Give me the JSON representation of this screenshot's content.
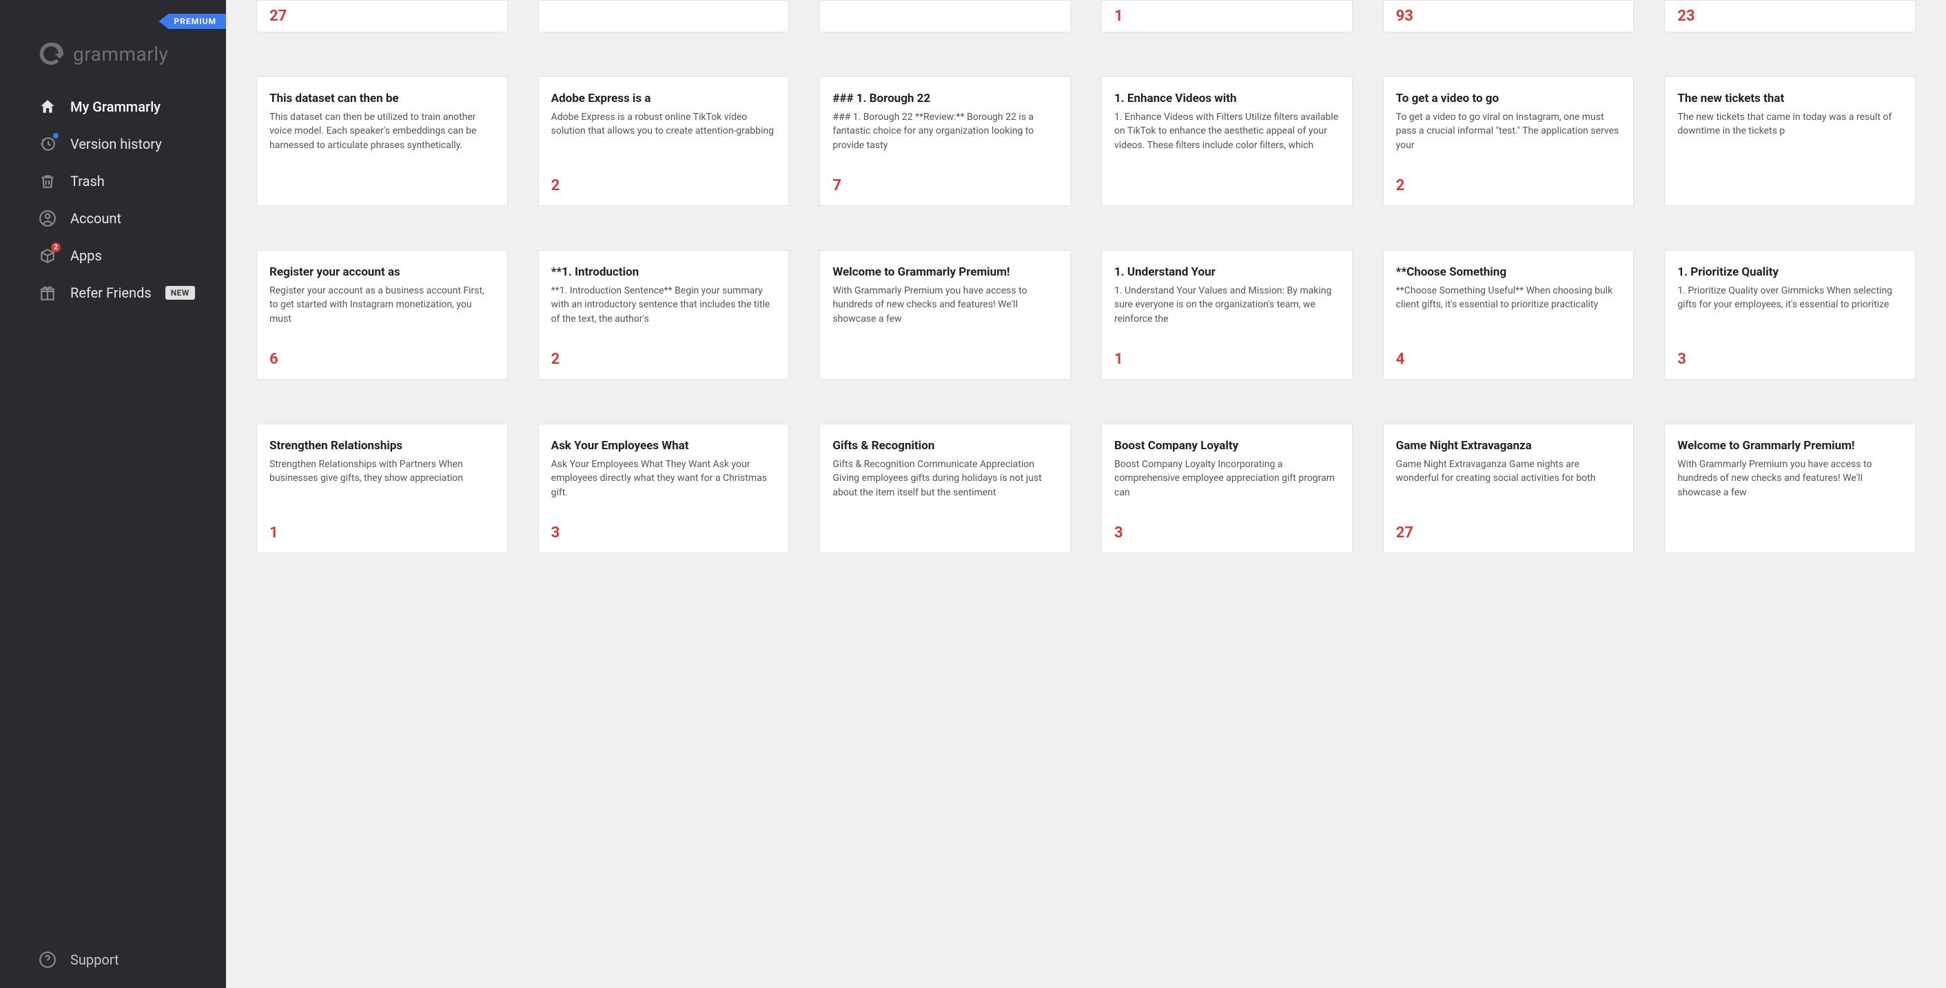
{
  "premium_label": "PREMIUM",
  "brand": "grammarly",
  "nav": {
    "my_grammarly": "My Grammarly",
    "version_history": "Version history",
    "trash": "Trash",
    "account": "Account",
    "apps": "Apps",
    "apps_badge": "2",
    "refer": "Refer Friends",
    "new_pill": "NEW"
  },
  "support": "Support",
  "rows": [
    [
      {
        "partial": true,
        "count": "27"
      },
      {
        "partial": true
      },
      {
        "partial": true
      },
      {
        "partial": true,
        "count": "1"
      },
      {
        "partial": true,
        "count": "93"
      },
      {
        "partial": true,
        "count": "23"
      }
    ],
    [
      {
        "title": "This dataset can then be",
        "body": "This dataset can then be utilized to train another voice model. Each speaker's embeddings can be harnessed to articulate phrases synthetically."
      },
      {
        "title": "Adobe Express is a",
        "body": "Adobe Express is a robust online TikTok video solution that allows you to create attention-grabbing",
        "count": "2"
      },
      {
        "title": "### 1. Borough 22",
        "body": "### 1. Borough 22 **Review:** Borough 22 is a fantastic choice for any organization looking to provide tasty",
        "count": "7"
      },
      {
        "title": "1. Enhance Videos with",
        "body": "1. Enhance Videos with Filters Utilize filters available on TikTok to enhance the aesthetic appeal of your videos. These filters include color filters, which"
      },
      {
        "title": "To get a video to go",
        "body": "To get a video to go viral on Instagram, one must pass a crucial informal \"test.\" The application serves your",
        "count": "2"
      },
      {
        "title": "The new tickets that",
        "body": "The new tickets that came in today was a result of downtime in the tickets p"
      }
    ],
    [
      {
        "title": "Register your account as",
        "body": "Register your account as a business account First, to get started with Instagram monetization, you must",
        "count": "6"
      },
      {
        "title": "**1. Introduction",
        "body": "**1. Introduction Sentence** Begin your summary with an introductory sentence that includes the title of the text, the author's",
        "count": "2"
      },
      {
        "title": "Welcome to Grammarly Premium!",
        "body": "With Grammarly Premium you have access to hundreds of new checks and features! We'll showcase a few"
      },
      {
        "title": "1. Understand Your",
        "body": "1. Understand Your Values and Mission: By making sure everyone is on the organization's team, we reinforce the",
        "count": "1"
      },
      {
        "title": "**Choose Something",
        "body": "**Choose Something Useful** When choosing bulk client gifts, it's essential to prioritize practicality",
        "count": "4"
      },
      {
        "title": "1. Prioritize Quality",
        "body": "1. Prioritize Quality over Gimmicks When selecting gifts for your employees, it's essential to prioritize",
        "count": "3"
      }
    ],
    [
      {
        "title": "Strengthen Relationships",
        "body": "Strengthen Relationships with Partners When businesses give gifts, they show appreciation",
        "count": "1"
      },
      {
        "title": "Ask Your Employees What",
        "body": "Ask Your Employees What They Want Ask your employees directly what they want for a Christmas gift.",
        "count": "3"
      },
      {
        "title": "Gifts & Recognition",
        "body": "Gifts & Recognition Communicate Appreciation Giving employees gifts during holidays is not just about the item itself but the sentiment"
      },
      {
        "title": "Boost Company Loyalty",
        "body": "Boost Company Loyalty Incorporating a comprehensive employee appreciation gift program can",
        "count": "3"
      },
      {
        "title": "Game Night Extravaganza",
        "body": "Game Night Extravaganza Game nights are wonderful for creating social activities for both",
        "count": "27"
      },
      {
        "title": "Welcome to Grammarly Premium!",
        "body": "With Grammarly Premium you have access to hundreds of new checks and features! We'll showcase a few"
      }
    ]
  ]
}
